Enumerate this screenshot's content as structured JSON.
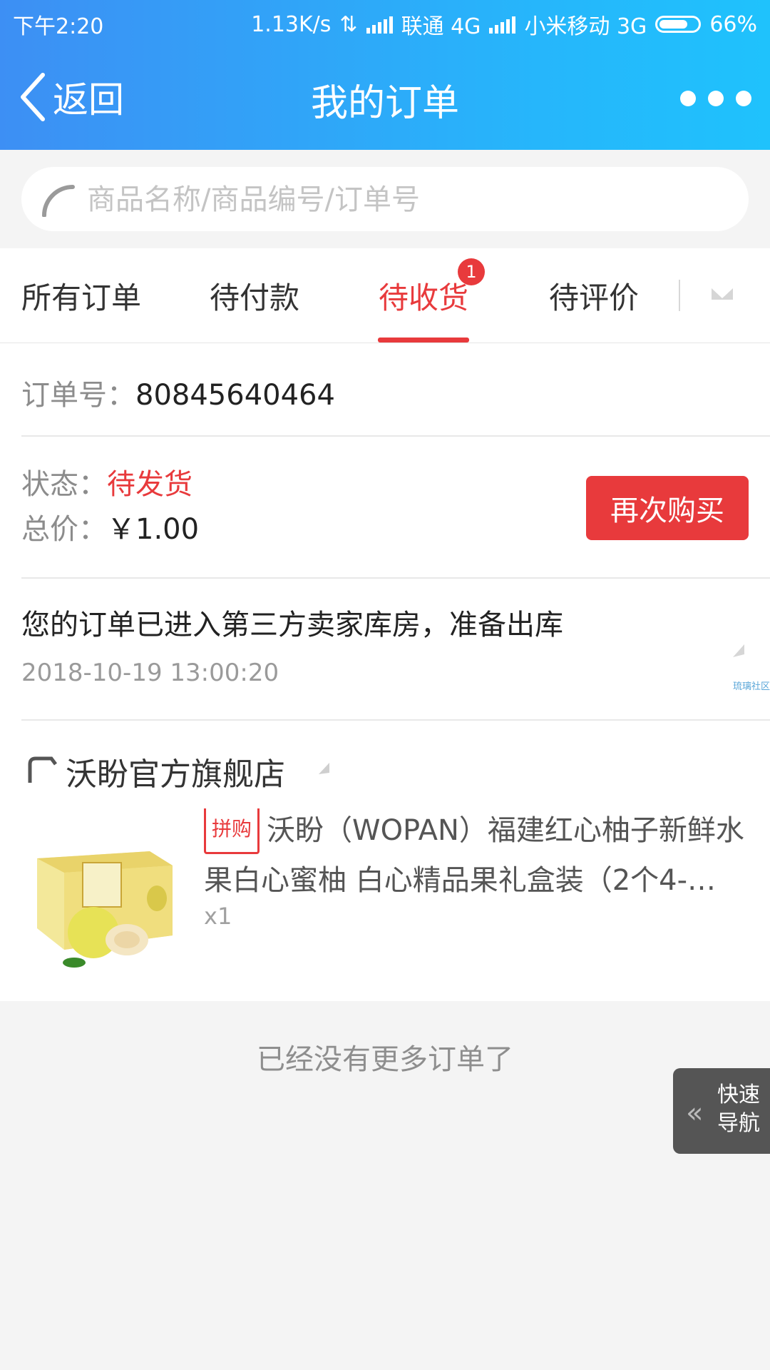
{
  "status_bar": {
    "time": "下午2:20",
    "net_speed": "1.13K/s",
    "carrier1": "联通 4G",
    "carrier2": "小米移动 3G",
    "battery": "66%",
    "battery_level": 0.66
  },
  "header": {
    "back_label": "返回",
    "title": "我的订单"
  },
  "search": {
    "placeholder": "商品名称/商品编号/订单号",
    "value": ""
  },
  "tabs": [
    {
      "label": "所有订单",
      "active": false
    },
    {
      "label": "待付款",
      "active": false
    },
    {
      "label": "待收货",
      "active": true,
      "badge": "1"
    },
    {
      "label": "待评价",
      "active": false
    }
  ],
  "order": {
    "number_label": "订单号：",
    "number": "80845640464",
    "status_label": "状态：",
    "status": "待发货",
    "total_label": "总价：",
    "total": "￥1.00",
    "rebuy_label": "再次购买",
    "tracking_message": "您的订单已进入第三方卖家库房，准备出库",
    "tracking_time": "2018-10-19 13:00:20",
    "store_name": "沃盼官方旗舰店",
    "product": {
      "tag": "拼购",
      "title": "沃盼（WOPAN）福建红心柚子新鲜水果白心蜜柚 白心精品果礼盒装（2个4-…",
      "quantity": "x1"
    }
  },
  "watermark": "琉璃社区",
  "footer": {
    "no_more_text": "已经没有更多订单了"
  },
  "quick_nav": {
    "line1": "快速",
    "line2": "导航"
  },
  "colors": {
    "accent": "#e83a3c",
    "header_start": "#3d8ff4",
    "header_end": "#1fc2fc"
  }
}
